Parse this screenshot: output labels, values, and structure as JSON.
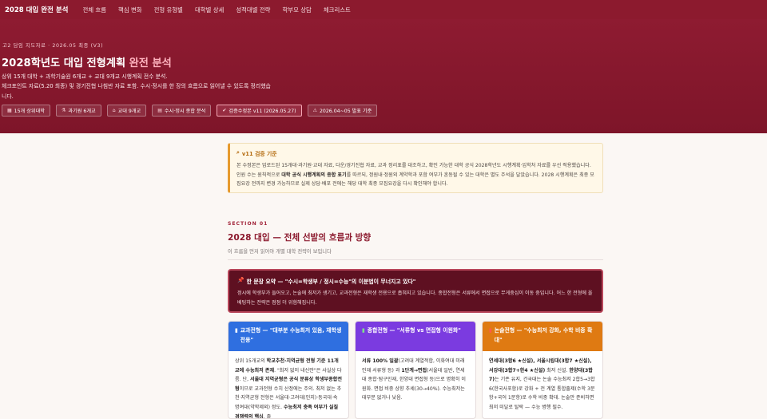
{
  "nav": {
    "brand_main": "2028 대입",
    "brand_sub": "완전 분석",
    "links": [
      "전체 흐름",
      "핵심 변화",
      "전형 유형별",
      "대학별 상세",
      "성적대별 전략",
      "학부모 상담",
      "체크리스트"
    ]
  },
  "hero": {
    "eyebrow": "고2 담임 지도자료 · 2026.05 최종 (V3)",
    "title_main": "2028학년도 대입 전형계획",
    "title_accent": "완전 분석",
    "desc_line1": "상위 15개 대학 + 과학기술원 6개교 + 교대 9개교 시행계획 전수 분석.",
    "desc_line2": "체크포인트 자료(5.20 최종) 및 경기진협 나침반 자료 포함. 수시·정시를 한 장의 흐름으로 읽어낼 수 있도록 정리했습니다.",
    "chips": [
      {
        "icon": "building-icon",
        "glyph": "▦",
        "label": "15개 상위대학"
      },
      {
        "icon": "flask-icon",
        "glyph": "⚗",
        "label": "과기원 6개교"
      },
      {
        "icon": "school-icon",
        "glyph": "⌂",
        "label": "교대 9개교"
      },
      {
        "icon": "document-icon",
        "glyph": "▤",
        "label": "수시·정시 종합 분석"
      },
      {
        "icon": "check-icon",
        "glyph": "✔",
        "label": "검증수정본 v11 (2026.05.27)"
      },
      {
        "icon": "warning-icon",
        "glyph": "⚠",
        "label": "2026.04~05 발표 기준"
      }
    ]
  },
  "notice": {
    "icon": "magnifier-icon",
    "title": "v11 검증 기준",
    "text_a": "본 수정본은 업로드된 15개대·과기원·교대 자료, 다운/경기진협 자료, 교과 정리표를 대조하고, 확인 가능한 대학 공식 2028학년도 시행계획·입학처 자료를 우선 적용했습니다. 인원 수는 원칙적으로 ",
    "text_bold": "대학 공식 시행계획의 종합 표기",
    "text_b": "를 따르되, 정원내·정원외 계약학과 포함 여부가 혼동될 수 있는 대학은 별도 주석을 달았습니다. 2028 시행계획은 최종 모집요강 전까지 변경 가능하므로 실제 상담·배포 전에는 해당 대학 최종 모집요강을 다시 확인해야 합니다."
  },
  "section": {
    "label": "SECTION 01",
    "title": "2028 대입 — 전체 선발의 흐름과 방향",
    "subtitle": "이 흐름을 먼저 읽어야 개별 대학 전략이 보입니다"
  },
  "summary": {
    "icon": "pin-icon",
    "title": "한 문장 요약 — \"수시=학생부 / 정시=수능\"의 이분법이 무너지고 있다\"",
    "text": "정시에 학생부가 들어오고, 논술에 최저가 생기고, 교과전형은 재학생 전용으로 좁혀지고 있습니다. 종합전형은 서류에서 면접으로 무게중심이 이동 중입니다. 어느 한 전형에 올베팅하는 전략은 점점 더 위험해집니다."
  },
  "cards": [
    {
      "icon": "book-icon",
      "glyph": "▮",
      "title": "교과전형 — \"대부분 수능최저 있음, 재학생 전용\"",
      "body_a": "상위 15개교의 ",
      "body_b1": "학교추천·지역균형 전형 기준 11개교에 수능최저 존재",
      "body_c": ". \"최저 없이 내신만\"은 사실상 다름. 단, ",
      "body_b2": "서울대 지역균형은 공식 분류상 학생부종합전형",
      "body_d": "이므로 교과전형 수치 산정에는 주의. 최저 없는 추천·지역균형 전형은 서울대·고려대(인지)·동국대·숙명여대(약학제외) 정도. ",
      "body_b3": "수능최저 충족 여부가 실질 경쟁력의 핵심",
      "body_e": ". 졸"
    },
    {
      "icon": "green-book-icon",
      "glyph": "▮",
      "title": "종합전형 — \"서류형 vs 면접형 이원화\"",
      "body_b1": "서류 100% 일괄",
      "body_a": "(고려대 계열적합, 이화여대 미래인재 서류형 등) 과 ",
      "body_b2": "1단계→면접",
      "body_c": "(서울대 일반, 연세대 종합·탐구인재, 한양대 면접형 등)으로 명확히 이원화. 면접 비중 상향 추세(30→40%). 수능최저는 대부분 없거나 낮음."
    },
    {
      "icon": "red-book-icon",
      "glyph": "▮",
      "title": "논술전형 — \"수능최저 강화, 수학 비중 확대\"",
      "body_b1": "연세대(3합6 ★신설), 서울시립대(3합7 ★신설), 서강대(3합7+한4 ★신설)",
      "body_a": " 최저 신설. ",
      "body_b2": "한양대(3합7)",
      "body_c": "는 기존 유지, 건국대는 논술 수능최저 2합5→3합6(한국사포함)로 강화 + 전 계열 통합출제(수학 3문항+국어 1문항)로 수학 비중 확대. 논술만 준비하면 최저 미달로 탈락 — 수능 병행 필수."
    }
  ]
}
